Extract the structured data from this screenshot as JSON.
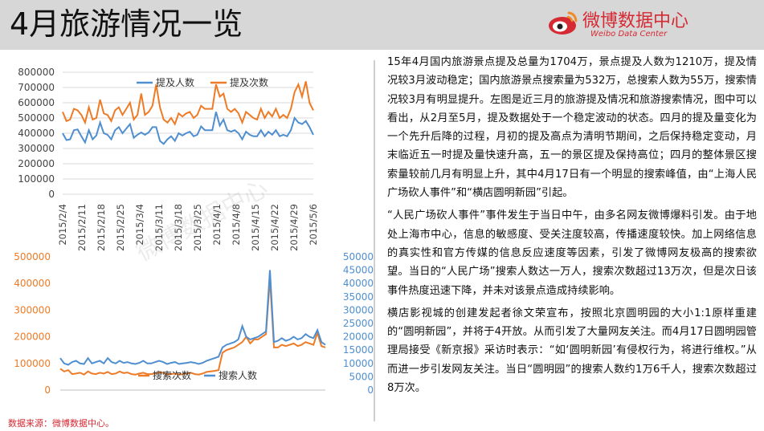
{
  "page": {
    "title": "4月旅游情况一览",
    "logo_cn": "微博数据中心",
    "logo_en": "Weibo Data Center",
    "source": "数据来源：微博数据中心。",
    "watermark": "微博数据中心"
  },
  "text": {
    "p1": "15年4月国内旅游景点提及总量为1704万，景点提及人数为1210万，提及情况较3月波动稳定；国内旅游景点搜索量为532万，总搜索人数为55万，搜索情况较3月有明显提升。左图是近三月的旅游提及情况和旅游搜索情况，图中可以看出，从2月至5月，提及数据处于一个稳定波动的状态。四月的提及量变化为一个先升后降的过程，月初的提及高点为清明节期间，之后保持稳定变动，月末临近五一时提及量快速升高，五一的景区提及保持高位；四月的整体景区搜索量较前几月有明显上升，其中4月17日有一个明显的搜索峰值，由“上海人民广场砍人事件”和“横店圆明新园”引起。",
    "p2": "“人民广场砍人事件”事件发生于当日中午，由多名网友微博爆料引发。由于地处上海市中心，信息的敏感度、受关注度较高，传播速度较快。加上网络信息的真实性和官方传媒的信息反应速度等因素，引发了微博网友极高的搜索欲望。当日的“人民广场”搜索人数达一万人，搜索次数超过13万次，但是次日该事件热度迅速下降，并未对该景点造成持续影响。",
    "p3": "横店影视城的创建发起者徐文荣宣布，按照北京圆明园的大小1:1原样重建的“圆明新园”，并将于4开放。从而引发了大量网友关注。而4月17日圆明园管理局接受《新京报》采访时表示：“如‘圆明新园’有侵权行为，将进行维权。”从而进一步引发网友关注。当日“圆明园”的搜索人数约1万6千人，搜索次数超过8万次。"
  },
  "colors": {
    "blue": "#4f8fd0",
    "orange": "#ee7b26",
    "accent": "#d52a33"
  },
  "chart_data": [
    {
      "type": "line",
      "legend_position": "top",
      "grid": true,
      "x": [
        "2015/2/4",
        "2015/2/11",
        "2015/2/18",
        "2015/2/25",
        "2015/3/4",
        "2015/3/11",
        "2015/3/18",
        "2015/3/25",
        "2015/4/1",
        "2015/4/8",
        "2015/4/15",
        "2015/4/22",
        "2015/4/29",
        "2015/5/6"
      ],
      "ylim": [
        0,
        800000
      ],
      "yticks": [
        "0",
        "100000",
        "200000",
        "300000",
        "400000",
        "500000",
        "600000",
        "700000",
        "800000"
      ],
      "series": [
        {
          "name": "提及人数",
          "color": "#4f8fd0",
          "values": [
            400000,
            355000,
            360000,
            420000,
            425000,
            380000,
            340000,
            420000,
            360000,
            385000,
            470000,
            400000,
            390000,
            360000,
            420000,
            440000,
            400000,
            430000,
            460000,
            370000,
            390000,
            405000,
            390000,
            405000,
            440000,
            440000,
            350000,
            330000,
            360000,
            380000,
            350000,
            400000,
            385000,
            400000,
            410000,
            380000,
            390000,
            445000,
            420000,
            420000,
            420000,
            540000,
            450000,
            490000,
            420000,
            410000,
            420000,
            400000,
            360000,
            410000,
            390000,
            380000,
            380000,
            420000,
            380000,
            410000,
            390000,
            420000,
            380000,
            390000,
            380000,
            420000,
            500000,
            470000,
            460000,
            480000,
            440000,
            390000
          ]
        },
        {
          "name": "提及次数",
          "color": "#ee7b26",
          "values": [
            540000,
            480000,
            490000,
            560000,
            550000,
            520000,
            470000,
            570000,
            490000,
            500000,
            620000,
            530000,
            520000,
            480000,
            550000,
            570000,
            520000,
            560000,
            600000,
            490000,
            520000,
            660000,
            520000,
            540000,
            580000,
            720000,
            570000,
            490000,
            470000,
            500000,
            460000,
            530000,
            510000,
            530000,
            540000,
            500000,
            520000,
            580000,
            560000,
            560000,
            560000,
            720000,
            640000,
            660000,
            560000,
            540000,
            560000,
            530000,
            470000,
            540000,
            520000,
            500000,
            490000,
            560000,
            500000,
            540000,
            510000,
            560000,
            500000,
            520000,
            500000,
            560000,
            670000,
            720000,
            640000,
            740000,
            600000,
            550000
          ]
        }
      ]
    },
    {
      "type": "line",
      "legend_position": "bottom",
      "grid": false,
      "x": [
        "2015/2/4",
        "2015/2/11",
        "2015/2/18",
        "2015/2/25",
        "2015/3/4",
        "2015/3/11",
        "2015/3/18",
        "2015/3/25",
        "2015/4/1",
        "2015/4/8",
        "2015/4/15",
        "2015/4/22",
        "2015/4/29",
        "2015/5/6"
      ],
      "ylim_left": [
        0,
        500000
      ],
      "ylim_right": [
        0,
        50000
      ],
      "yticks_left": [
        "0",
        "100000",
        "200000",
        "300000",
        "400000",
        "500000"
      ],
      "yticks_right": [
        "0",
        "5000",
        "10000",
        "15000",
        "20000",
        "25000",
        "30000",
        "35000",
        "40000",
        "45000",
        "50000"
      ],
      "series": [
        {
          "name": "搜索次数",
          "axis": "left",
          "color": "#ee7b26",
          "values": [
            80000,
            70000,
            75000,
            60000,
            62000,
            65000,
            58000,
            70000,
            62000,
            60000,
            65000,
            62000,
            68000,
            60000,
            62000,
            70000,
            64000,
            66000,
            60000,
            58000,
            62000,
            65000,
            60000,
            60000,
            62000,
            66000,
            65000,
            58000,
            60000,
            62000,
            58000,
            60000,
            62000,
            65000,
            60000,
            58000,
            62000,
            68000,
            70000,
            72000,
            75000,
            140000,
            150000,
            155000,
            160000,
            170000,
            180000,
            200000,
            175000,
            190000,
            190000,
            200000,
            210000,
            420000,
            160000,
            160000,
            170000,
            165000,
            170000,
            175000,
            165000,
            170000,
            180000,
            175000,
            170000,
            215000,
            165000,
            160000
          ]
        },
        {
          "name": "搜索人数",
          "axis": "right",
          "color": "#4f8fd0",
          "values": [
            12000,
            10000,
            9500,
            10500,
            11000,
            10000,
            9800,
            12000,
            10000,
            10500,
            11000,
            10000,
            12000,
            10500,
            10000,
            11000,
            10200,
            10500,
            10000,
            9800,
            10200,
            11000,
            10000,
            10000,
            10500,
            11000,
            10500,
            9800,
            10200,
            10500,
            9800,
            10000,
            10200,
            10500,
            10200,
            9800,
            10200,
            11000,
            11500,
            12000,
            12500,
            16000,
            17000,
            17500,
            18000,
            19000,
            24000,
            20000,
            19000,
            19500,
            20000,
            21000,
            22000,
            45000,
            18000,
            18500,
            19500,
            18500,
            19000,
            20000,
            19000,
            19500,
            21000,
            20000,
            19500,
            22500,
            18000,
            17000
          ]
        }
      ]
    }
  ]
}
